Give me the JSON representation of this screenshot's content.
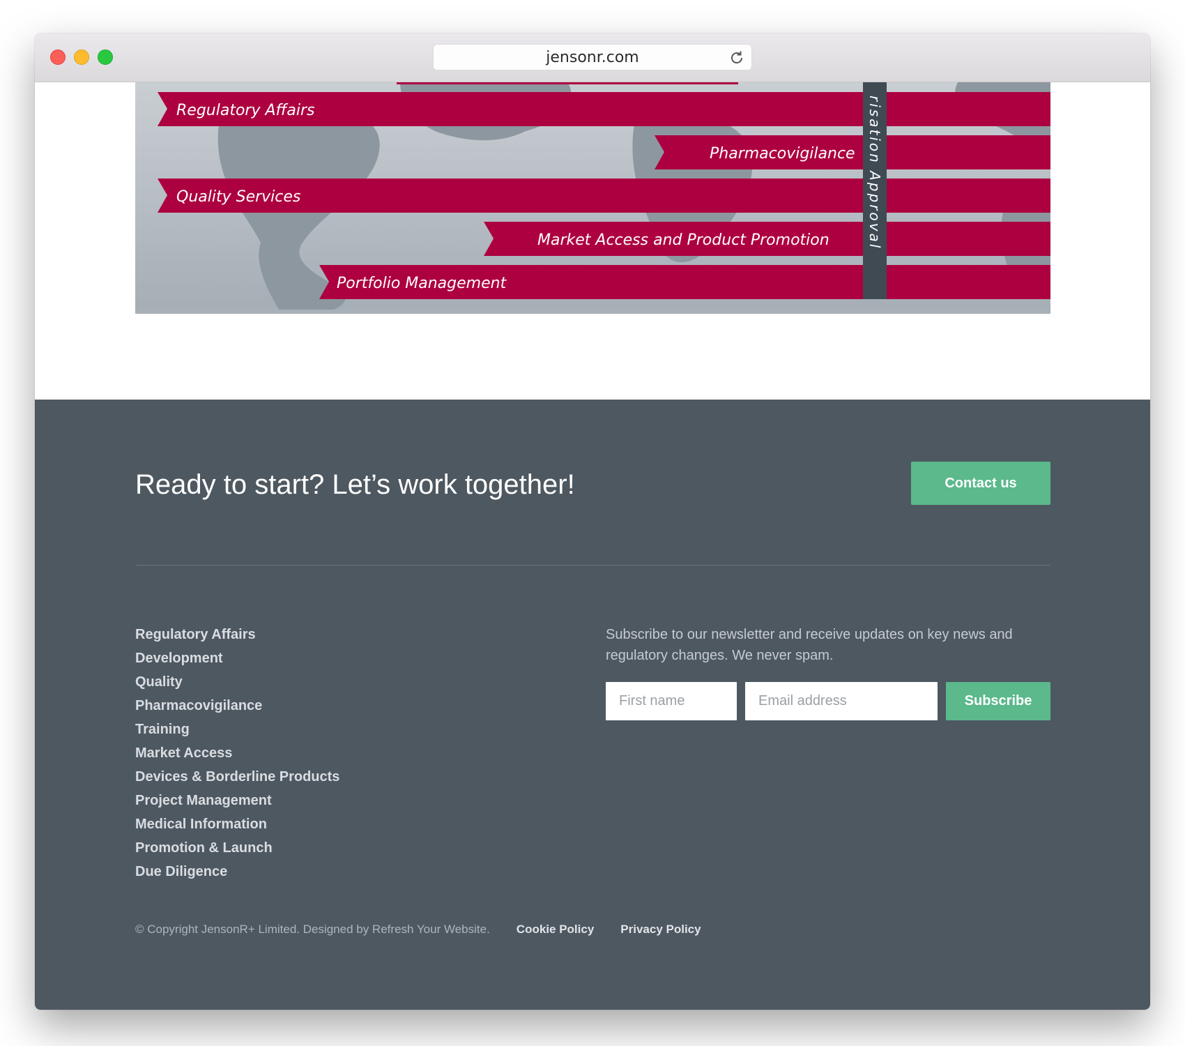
{
  "browser": {
    "url": "jensonr.com"
  },
  "hero": {
    "banners": [
      "Regulatory Affairs",
      "Pharmacovigilance",
      "Quality Services",
      "Market Access and Product Promotion",
      "Portfolio Management"
    ],
    "vertical_label": "risation Approval",
    "colors": {
      "banner": "#ad0040",
      "vertical_bar": "#3f4a53",
      "map_bg": "#b7bec5"
    }
  },
  "footer": {
    "cta_title": "Ready to start? Let’s work together!",
    "contact_label": "Contact us",
    "links": [
      "Regulatory Affairs",
      "Development",
      "Quality",
      "Pharmacovigilance",
      "Training",
      "Market Access",
      "Devices & Borderline Products",
      "Project Management",
      "Medical Information",
      "Promotion & Launch",
      "Due Diligence"
    ],
    "newsletter_text": "Subscribe to our newsletter and receive updates on key news and regulatory changes. We never spam.",
    "first_name_placeholder": "First name",
    "email_placeholder": "Email address",
    "subscribe_label": "Subscribe",
    "copyright": "© Copyright JensonR+ Limited. Designed by Refresh Your Website.",
    "cookie_policy": "Cookie Policy",
    "privacy_policy": "Privacy Policy",
    "colors": {
      "background": "#4e5861",
      "accent": "#5bb98c"
    }
  }
}
